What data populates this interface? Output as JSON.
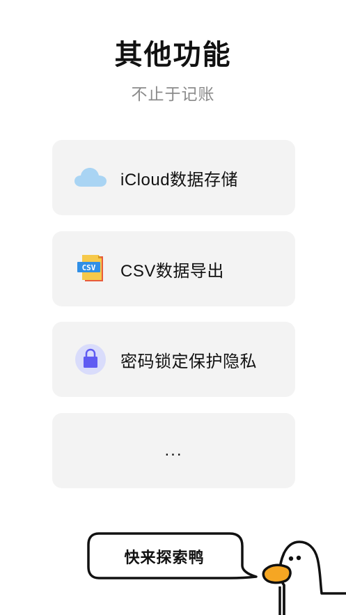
{
  "header": {
    "title": "其他功能",
    "subtitle": "不止于记账"
  },
  "features": [
    {
      "label": "iCloud数据存储",
      "icon": "cloud-icon"
    },
    {
      "label": "CSV数据导出",
      "icon": "csv-file-icon",
      "icon_text": "CSV"
    },
    {
      "label": "密码锁定保护隐私",
      "icon": "lock-icon"
    },
    {
      "label": "..."
    }
  ],
  "mascot": {
    "speech": "快来探索鸭",
    "icon": "duck-mascot"
  },
  "colors": {
    "card_bg": "#f3f3f3",
    "cloud": "#a9d4f3",
    "csv_blue": "#2f8fe6",
    "csv_doc": "#f6c94a",
    "csv_fold": "#e85b3b",
    "lock_bg": "#d9dcfb",
    "lock": "#5f5bf2",
    "duck_beak": "#f5a623"
  }
}
